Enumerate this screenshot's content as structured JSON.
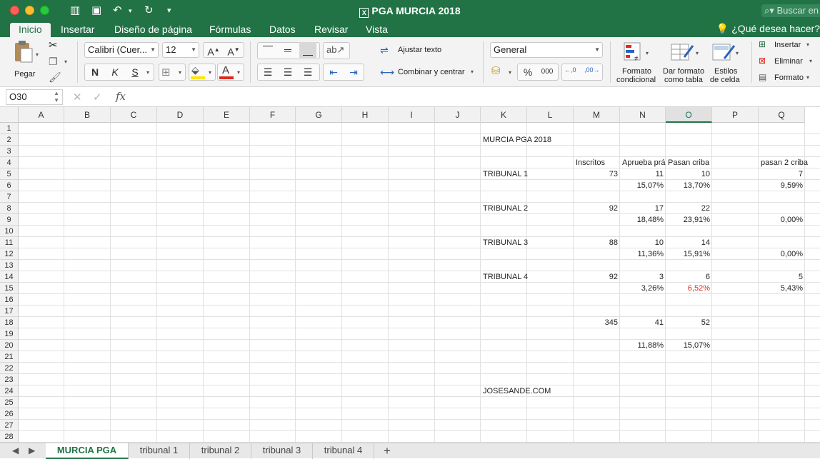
{
  "window": {
    "title": "PGA MURCIA 2018",
    "search_placeholder": "Buscar en"
  },
  "ribbon_tabs": [
    "Inicio",
    "Insertar",
    "Diseño de página",
    "Fórmulas",
    "Datos",
    "Revisar",
    "Vista"
  ],
  "active_ribbon_tab": "Inicio",
  "tell_me": "¿Qué desea hacer?",
  "ribbon": {
    "paste_label": "Pegar",
    "font_name": "Calibri (Cuer...",
    "font_size": "12",
    "bold": "N",
    "italic": "K",
    "underline": "S",
    "wrap_text": "Ajustar texto",
    "merge_center": "Combinar y centrar",
    "number_format": "General",
    "percent": "%",
    "thousands": "000",
    "cond_format_1": "Formato",
    "cond_format_2": "condicional",
    "format_table_1": "Dar formato",
    "format_table_2": "como tabla",
    "cell_styles_1": "Estilos",
    "cell_styles_2": "de celda",
    "insert": "Insertar",
    "delete": "Eliminar",
    "format": "Formato"
  },
  "formula_bar": {
    "name_box": "O30",
    "fx": "fx",
    "content": ""
  },
  "columns": [
    "A",
    "B",
    "C",
    "D",
    "E",
    "F",
    "G",
    "H",
    "I",
    "J",
    "K",
    "L",
    "M",
    "N",
    "O",
    "P",
    "Q"
  ],
  "selected_column": "O",
  "rows": [
    "1",
    "2",
    "3",
    "4",
    "5",
    "6",
    "7",
    "8",
    "9",
    "10",
    "11",
    "12",
    "13",
    "14",
    "15",
    "16",
    "17",
    "18",
    "19",
    "20",
    "21",
    "22",
    "23",
    "24",
    "25",
    "26",
    "27",
    "28"
  ],
  "cells": {
    "K2": "MURCIA PGA 2018",
    "M4": "Inscritos",
    "N4": "Aprueba práctico",
    "O4": "Pasan criba",
    "Q4": "pasan 2 criba",
    "K5": "TRIBUNAL 1",
    "M5": "73",
    "N5": "11",
    "O5": "10",
    "Q5": "7",
    "N6": "15,07%",
    "O6": "13,70%",
    "Q6": "9,59%",
    "K8": "TRIBUNAL 2",
    "M8": "92",
    "N8": "17",
    "O8": "22",
    "N9": "18,48%",
    "O9": "23,91%",
    "Q9": "0,00%",
    "K11": "TRIBUNAL 3",
    "M11": "88",
    "N11": "10",
    "O11": "14",
    "N12": "11,36%",
    "O12": "15,91%",
    "Q12": "0,00%",
    "K14": "TRIBUNAL 4",
    "M14": "92",
    "N14": "3",
    "O14": "6",
    "Q14": "5",
    "N15": "3,26%",
    "O15": "6,52%",
    "Q15": "5,43%",
    "M18": "345",
    "N18": "41",
    "O18": "52",
    "N20": "11,88%",
    "O20": "15,07%",
    "K24": "JOSESANDE.COM"
  },
  "red_cells": [
    "O15"
  ],
  "sheet_tabs": [
    "MURCIA PGA",
    "tribunal 1",
    "tribunal 2",
    "tribunal 3",
    "tribunal 4"
  ],
  "active_sheet": "MURCIA PGA",
  "colors": {
    "excel_green": "#217346",
    "negative_red": "#e0291d"
  }
}
